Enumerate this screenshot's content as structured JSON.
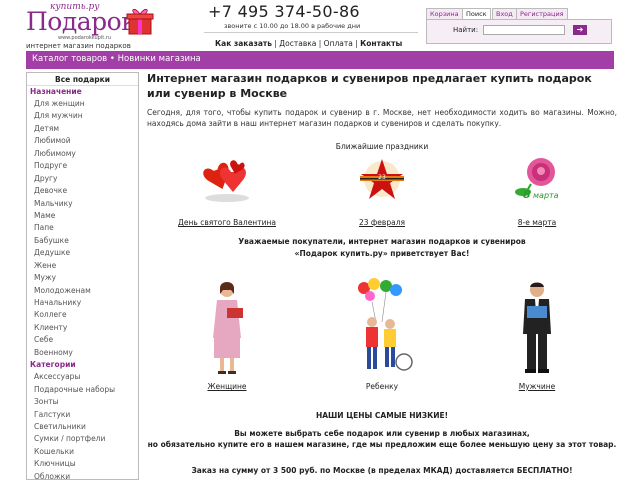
{
  "brand": {
    "logo_script": "купить.ру",
    "logo_text": "Подарок",
    "logo_url": "www.podarokkupit.ru",
    "tagline": "интернет магазин подарков"
  },
  "contact": {
    "phone": "+7 495 374-50-86",
    "hours": "звоните с 10.00 до 18.00 в рабочие дни"
  },
  "topnav": {
    "how_to_order": "Как заказать",
    "sep": " | ",
    "delivery": "Доставка",
    "payment": "Оплата",
    "contacts": "Контакты"
  },
  "tabs": [
    "Корзина",
    "Поиск",
    "Вход",
    "Регистрация"
  ],
  "active_tab": "Поиск",
  "search": {
    "label": "Найти:",
    "value": "",
    "button": "➔"
  },
  "breadcrumbs": {
    "catalog": "Каталог товаров",
    "sep": " • ",
    "new": "Новинки магазина"
  },
  "sidebar": {
    "title": "Все подарки",
    "purpose_title": "Назначение",
    "purpose_items": [
      "Для женщин",
      "Для мужчин",
      "Детям",
      "Любимой",
      "Любимому",
      "Подруге",
      "Другу",
      "Девочке",
      "Мальчику",
      "Маме",
      "Папе",
      "Бабушке",
      "Дедушке",
      "Жене",
      "Мужу",
      "Молодоженам",
      "Начальнику",
      "Коллеге",
      "Клиенту",
      "Себе",
      "Военному"
    ],
    "categories_title": "Категории",
    "category_items": [
      "Аксессуары",
      "Подарочные наборы",
      "Зонты",
      "Галстуки",
      "Светильники",
      "Сумки / портфели",
      "Кошельки",
      "Ключницы",
      "Обложки"
    ]
  },
  "main": {
    "title": "Интернет магазин подарков и сувениров предлагает купить подарок или сувенир в Москве",
    "intro": "Сегодня, для того, чтобы купить подарок и сувенир в г. Москве, нет необходимости ходить во магазины. Можно, находясь дома зайти в наш интернет магазин подарков и сувениров и сделать покупку.",
    "holidays_title": "Ближайшие праздники",
    "holidays": [
      {
        "label": "День святого Валентина",
        "icon": "hearts-icon"
      },
      {
        "label": "23 февраля",
        "icon": "star-icon"
      },
      {
        "label": "8-е марта",
        "icon": "rose-icon"
      }
    ],
    "greeting_line1": "Уважаемые покупатели, интернет магазин подарков и сувениров",
    "greeting_line2": "«Подарок купить.ру» приветствует Вас!",
    "targets": [
      {
        "label": "Женщине",
        "underlined": true
      },
      {
        "label": "Ребенку",
        "underlined": false
      },
      {
        "label": "Мужчине",
        "underlined": true
      }
    ],
    "prices_title": "НАШИ ЦЕНЫ САМЫЕ НИЗКИЕ!",
    "prices_line1": "Вы можете выбрать себе подарок или сувенир в любых магазинах,",
    "prices_line2": "но обязательно купите его в нашем магазине, где мы предложим еще более меньшую цену за этот товар.",
    "delivery_text": "Заказ на сумму от 3 500 руб. по Москве (в пределах МКАД) доставляется БЕСПЛАТНО!"
  },
  "colors": {
    "brand_purple": "#a23fa6",
    "link_purple": "#8a2a8a"
  }
}
